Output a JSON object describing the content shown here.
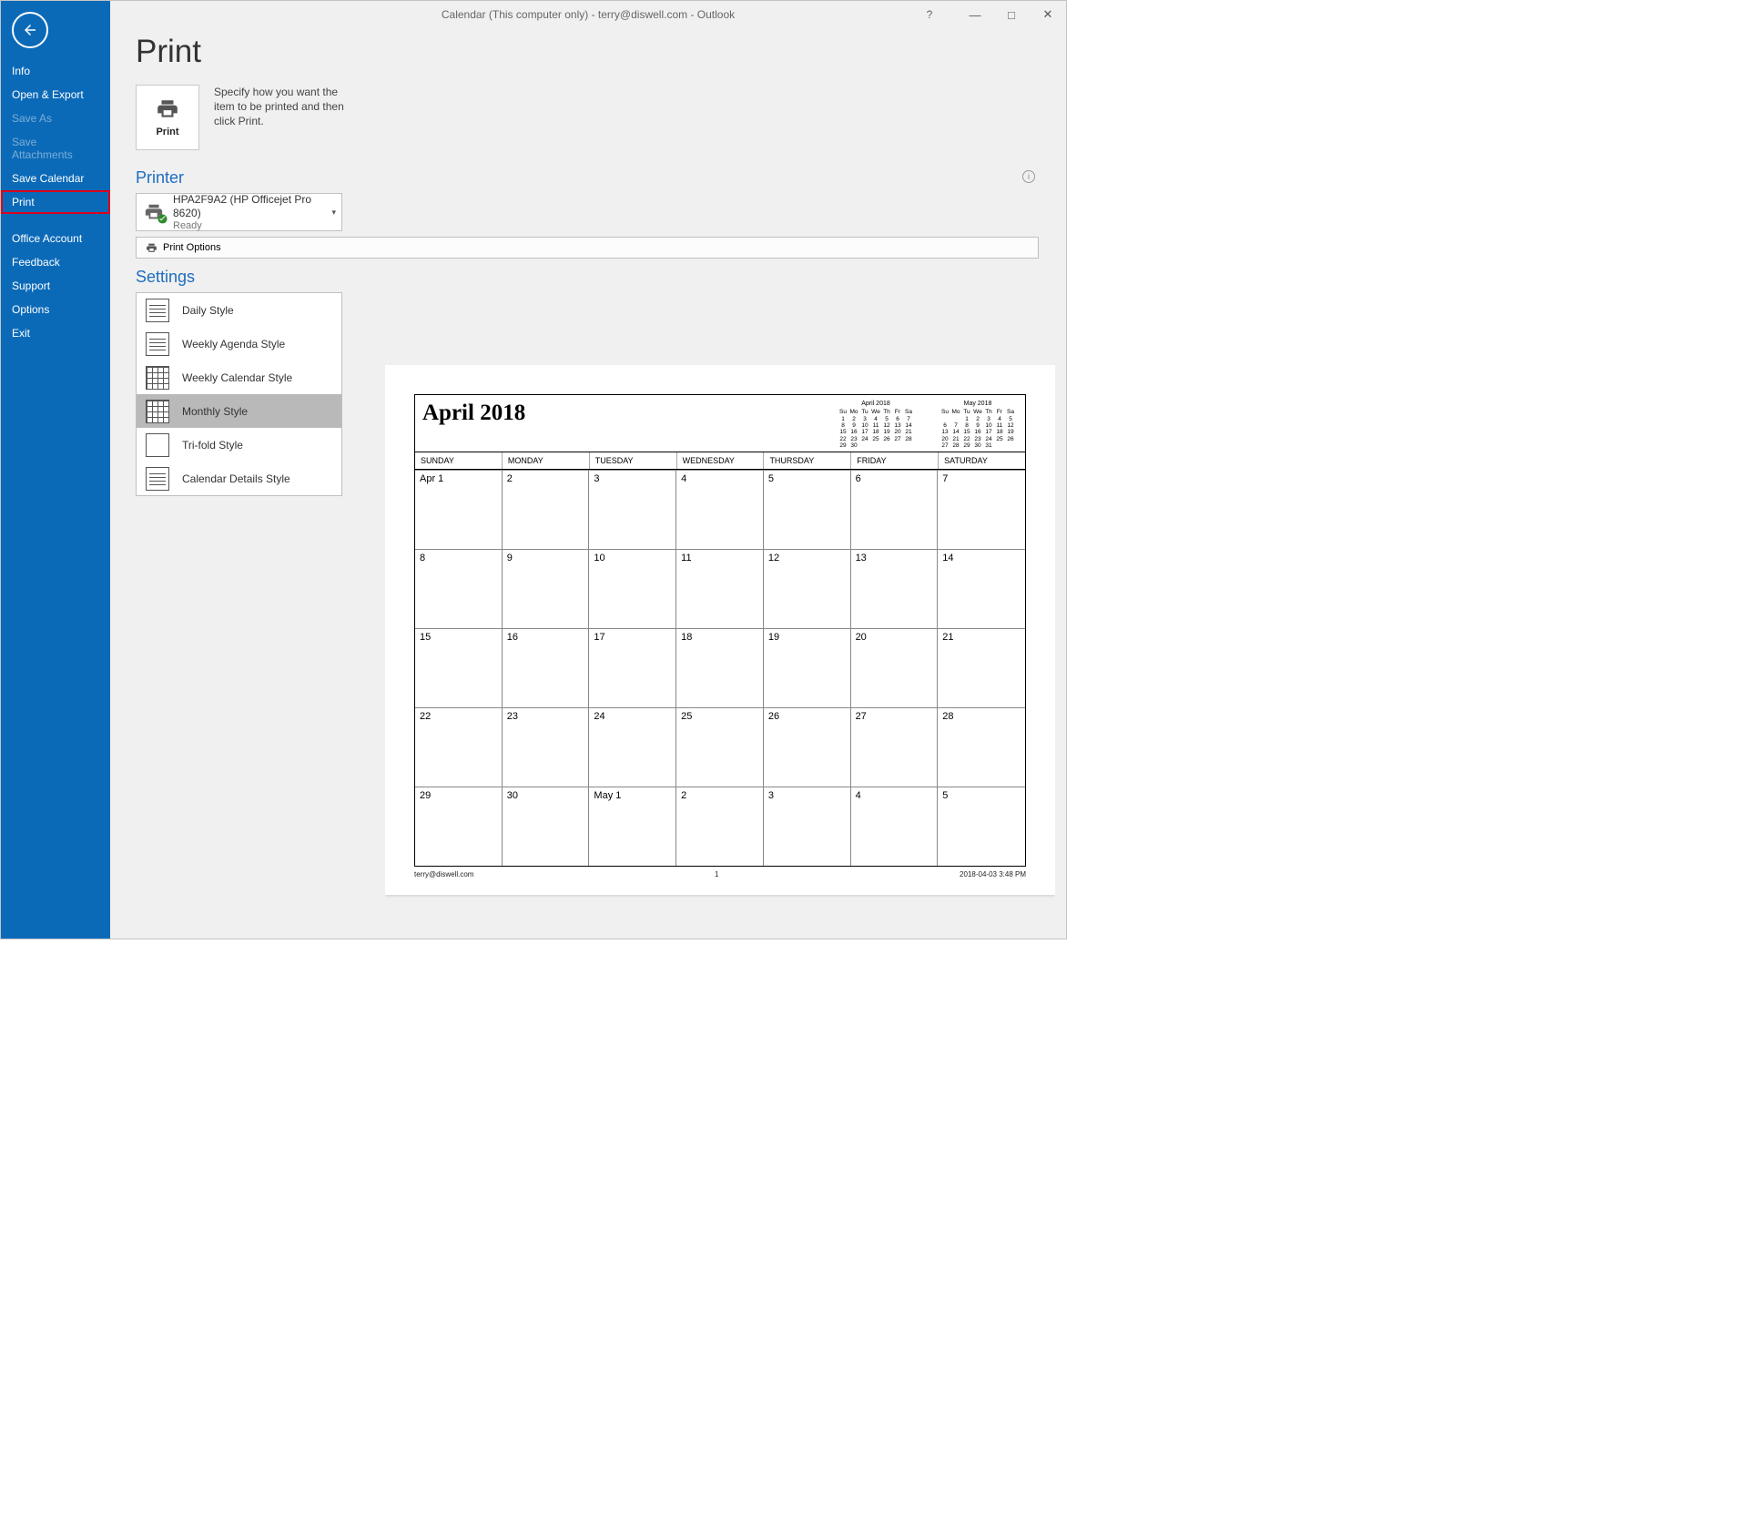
{
  "window": {
    "title": "Calendar (This computer only) - terry@diswell.com  -  Outlook",
    "help": "?",
    "minimize": "—",
    "maximize": "□",
    "close": "✕"
  },
  "sidebar": {
    "items": [
      {
        "label": "Info",
        "disabled": false
      },
      {
        "label": "Open & Export",
        "disabled": false
      },
      {
        "label": "Save As",
        "disabled": true
      },
      {
        "label": "Save Attachments",
        "disabled": true
      },
      {
        "label": "Save Calendar",
        "disabled": false
      },
      {
        "label": "Print",
        "disabled": false,
        "selected": true
      },
      {
        "label": "Office Account",
        "disabled": false,
        "gap_before": true
      },
      {
        "label": "Feedback",
        "disabled": false
      },
      {
        "label": "Support",
        "disabled": false
      },
      {
        "label": "Options",
        "disabled": false
      },
      {
        "label": "Exit",
        "disabled": false
      }
    ]
  },
  "main": {
    "heading": "Print",
    "print_button_label": "Print",
    "description": "Specify how you want the item to be printed and then click Print.",
    "printer_heading": "Printer",
    "printer": {
      "name": "HPA2F9A2 (HP Officejet Pro 8620)",
      "status": "Ready"
    },
    "print_options_label": "Print Options",
    "settings_heading": "Settings",
    "styles": [
      {
        "label": "Daily Style"
      },
      {
        "label": "Weekly Agenda Style"
      },
      {
        "label": "Weekly Calendar Style"
      },
      {
        "label": "Monthly Style",
        "selected": true
      },
      {
        "label": "Tri-fold Style"
      },
      {
        "label": "Calendar Details Style"
      }
    ]
  },
  "preview": {
    "title": "April 2018",
    "mini1_name": "April 2018",
    "mini2_name": "May 2018",
    "dow_short": [
      "Su",
      "Mo",
      "Tu",
      "We",
      "Th",
      "Fr",
      "Sa"
    ],
    "mini1_rows": [
      [
        "1",
        "2",
        "3",
        "4",
        "5",
        "6",
        "7"
      ],
      [
        "8",
        "9",
        "10",
        "11",
        "12",
        "13",
        "14"
      ],
      [
        "15",
        "16",
        "17",
        "18",
        "19",
        "20",
        "21"
      ],
      [
        "22",
        "23",
        "24",
        "25",
        "26",
        "27",
        "28"
      ],
      [
        "29",
        "30",
        "",
        "",
        "",
        "",
        ""
      ]
    ],
    "mini2_rows": [
      [
        "",
        "",
        "1",
        "2",
        "3",
        "4",
        "5"
      ],
      [
        "6",
        "7",
        "8",
        "9",
        "10",
        "11",
        "12"
      ],
      [
        "13",
        "14",
        "15",
        "16",
        "17",
        "18",
        "19"
      ],
      [
        "20",
        "21",
        "22",
        "23",
        "24",
        "25",
        "26"
      ],
      [
        "27",
        "28",
        "29",
        "30",
        "31",
        "",
        ""
      ]
    ],
    "dow": [
      "SUNDAY",
      "MONDAY",
      "TUESDAY",
      "WEDNESDAY",
      "THURSDAY",
      "FRIDAY",
      "SATURDAY"
    ],
    "cells": [
      "Apr 1",
      "2",
      "3",
      "4",
      "5",
      "6",
      "7",
      "8",
      "9",
      "10",
      "11",
      "12",
      "13",
      "14",
      "15",
      "16",
      "17",
      "18",
      "19",
      "20",
      "21",
      "22",
      "23",
      "24",
      "25",
      "26",
      "27",
      "28",
      "29",
      "30",
      "May 1",
      "2",
      "3",
      "4",
      "5"
    ],
    "footer_left": "terry@diswell.com",
    "footer_center": "1",
    "footer_right": "2018-04-03 3:48 PM"
  }
}
